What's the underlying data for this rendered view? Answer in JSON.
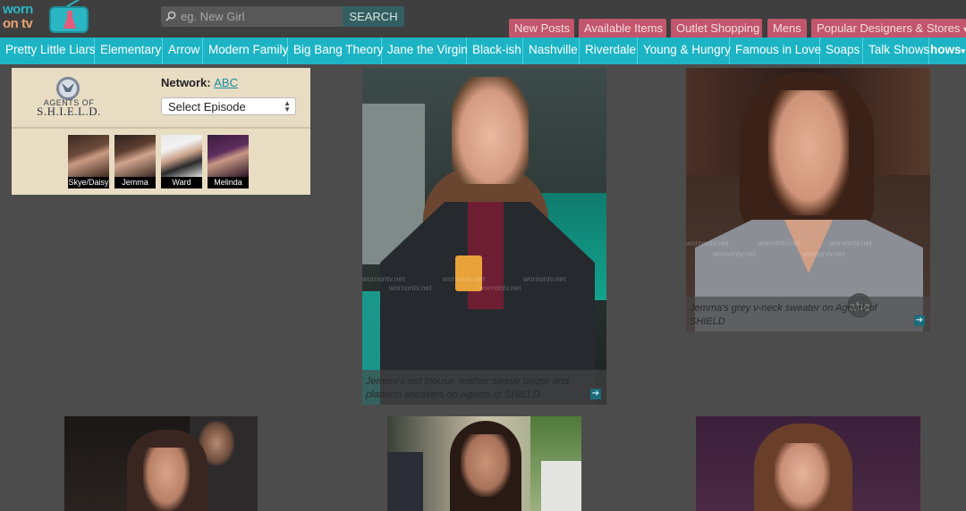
{
  "header": {
    "logo_line1": "worn",
    "logo_line2": "on tv",
    "search_placeholder": "eg. New Girl",
    "search_button": "SEARCH",
    "top_links": [
      "New Posts",
      "Available Items",
      "Outlet Shopping",
      "Mens",
      "Popular Designers & Stores"
    ],
    "dropdown_glyph": "▾"
  },
  "nav": {
    "items": [
      "Pretty Little Liars",
      "Elementary",
      "Arrow",
      "Modern Family",
      "Big Bang Theory",
      "Jane the Virgin",
      "Black-ish",
      "Nashville",
      "Riverdale",
      "Young & Hungry",
      "Famous in Love",
      "Soaps",
      "Talk Shows"
    ],
    "more_label": "hows",
    "more_glyph": "▾"
  },
  "show": {
    "logo_small": "AGENTS OF",
    "logo_big": "S.H.I.E.L.D.",
    "network_label": "Network:",
    "network_value": "ABC",
    "episode_select": "Select Episode",
    "characters": [
      "Skye/Daisy",
      "Jemma",
      "Ward",
      "Melinda"
    ]
  },
  "cards": [
    {
      "caption": "Jemma's red blouse, leather sleeve blazer and platform sneakers on Agents of SHIELD",
      "watermark": "wornontv.net"
    },
    {
      "caption": "Jemma's grey v-neck sweater on Agents of SHIELD",
      "watermark": "wornontv.net",
      "network_bug": "abc"
    },
    {
      "caption": ""
    },
    {
      "caption": ""
    },
    {
      "caption": ""
    }
  ],
  "colors": {
    "page_bg": "#4c4c4c",
    "header_bg": "#3f3f3f",
    "nav_bg": "#1cb4c4",
    "top_link_bg": "#c2566c",
    "panel_bg": "#e8dcc3",
    "link": "#1a8ea0"
  }
}
